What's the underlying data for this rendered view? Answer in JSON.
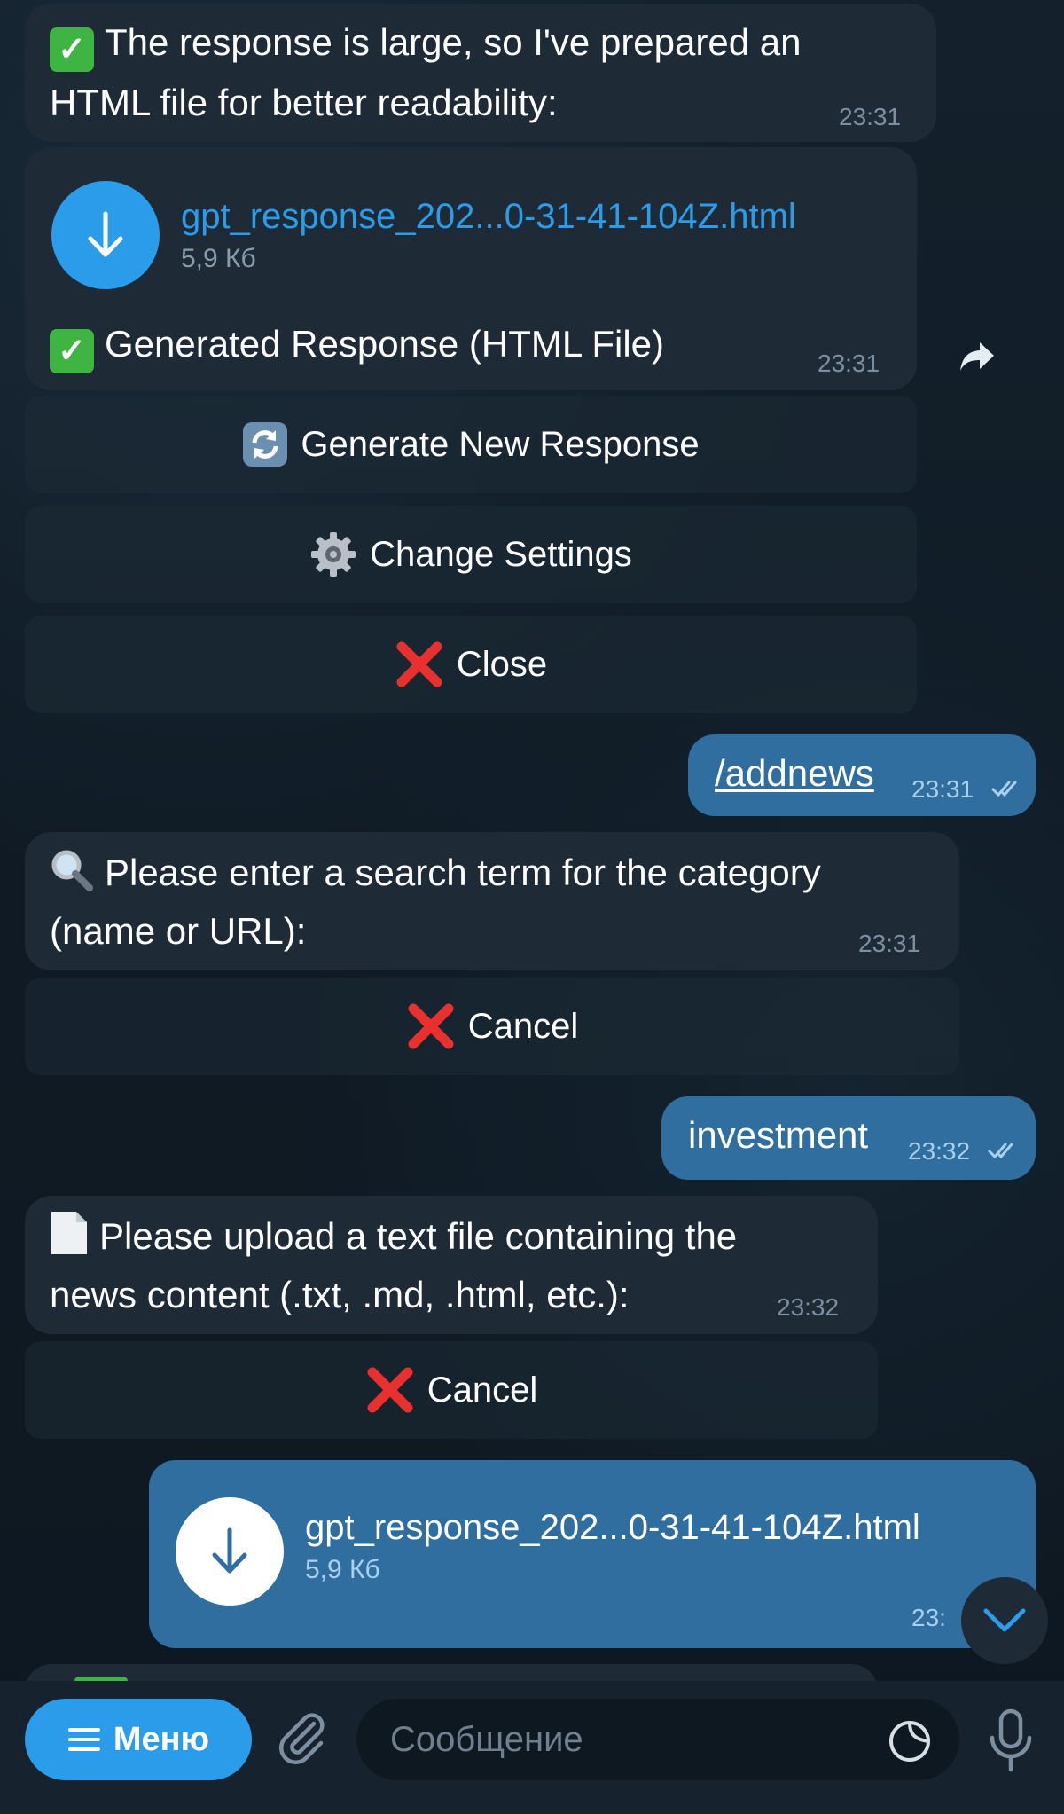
{
  "messages": {
    "m1": {
      "text_line1": "The response is large, so I've prepared an",
      "text_line2": "HTML file for better readability:",
      "time": "23:31"
    },
    "m2": {
      "file_name": "gpt_response_202...0-31-41-104Z.html",
      "file_size": "5,9 Кб",
      "caption": "Generated Response (HTML File)",
      "time": "23:31"
    },
    "buttons1": {
      "regenerate": "Generate New Response",
      "settings": "Change Settings",
      "close": "Close"
    },
    "m3": {
      "text": "/addnews",
      "time": "23:31"
    },
    "m4": {
      "text_line1": "Please enter a search term for the category",
      "text_line2": "(name or URL):",
      "time": "23:31"
    },
    "buttons2": {
      "cancel": "Cancel"
    },
    "m5": {
      "text": "investment",
      "time": "23:32"
    },
    "m6": {
      "text_line1": "Please upload a text file containing the",
      "text_line2": "news content (.txt, .md, .html, etc.):",
      "time": "23:32"
    },
    "buttons3": {
      "cancel": "Cancel"
    },
    "m7": {
      "file_name": "gpt_response_202...0-31-41-104Z.html",
      "file_size": "5,9 Кб",
      "time": "23:"
    }
  },
  "composer": {
    "menu_label": "Меню",
    "placeholder": "Сообщение"
  },
  "icons": {
    "check": "check-mark-button-icon",
    "download": "download-arrow-icon",
    "forward": "forward-icon",
    "refresh": "refresh-icon",
    "gear": "gear-icon",
    "cross": "cross-mark-icon",
    "search": "magnifier-icon",
    "page": "page-icon",
    "scroll_down": "chevron-down-icon",
    "attach": "paperclip-icon",
    "sticker": "sticker-icon",
    "mic": "microphone-icon"
  },
  "colors": {
    "accent": "#2a9cea",
    "incoming_bubble": "#1e2b37",
    "outgoing_bubble": "#2f6e9f",
    "check_green": "#3eb543",
    "cross_red": "#e8312f"
  }
}
